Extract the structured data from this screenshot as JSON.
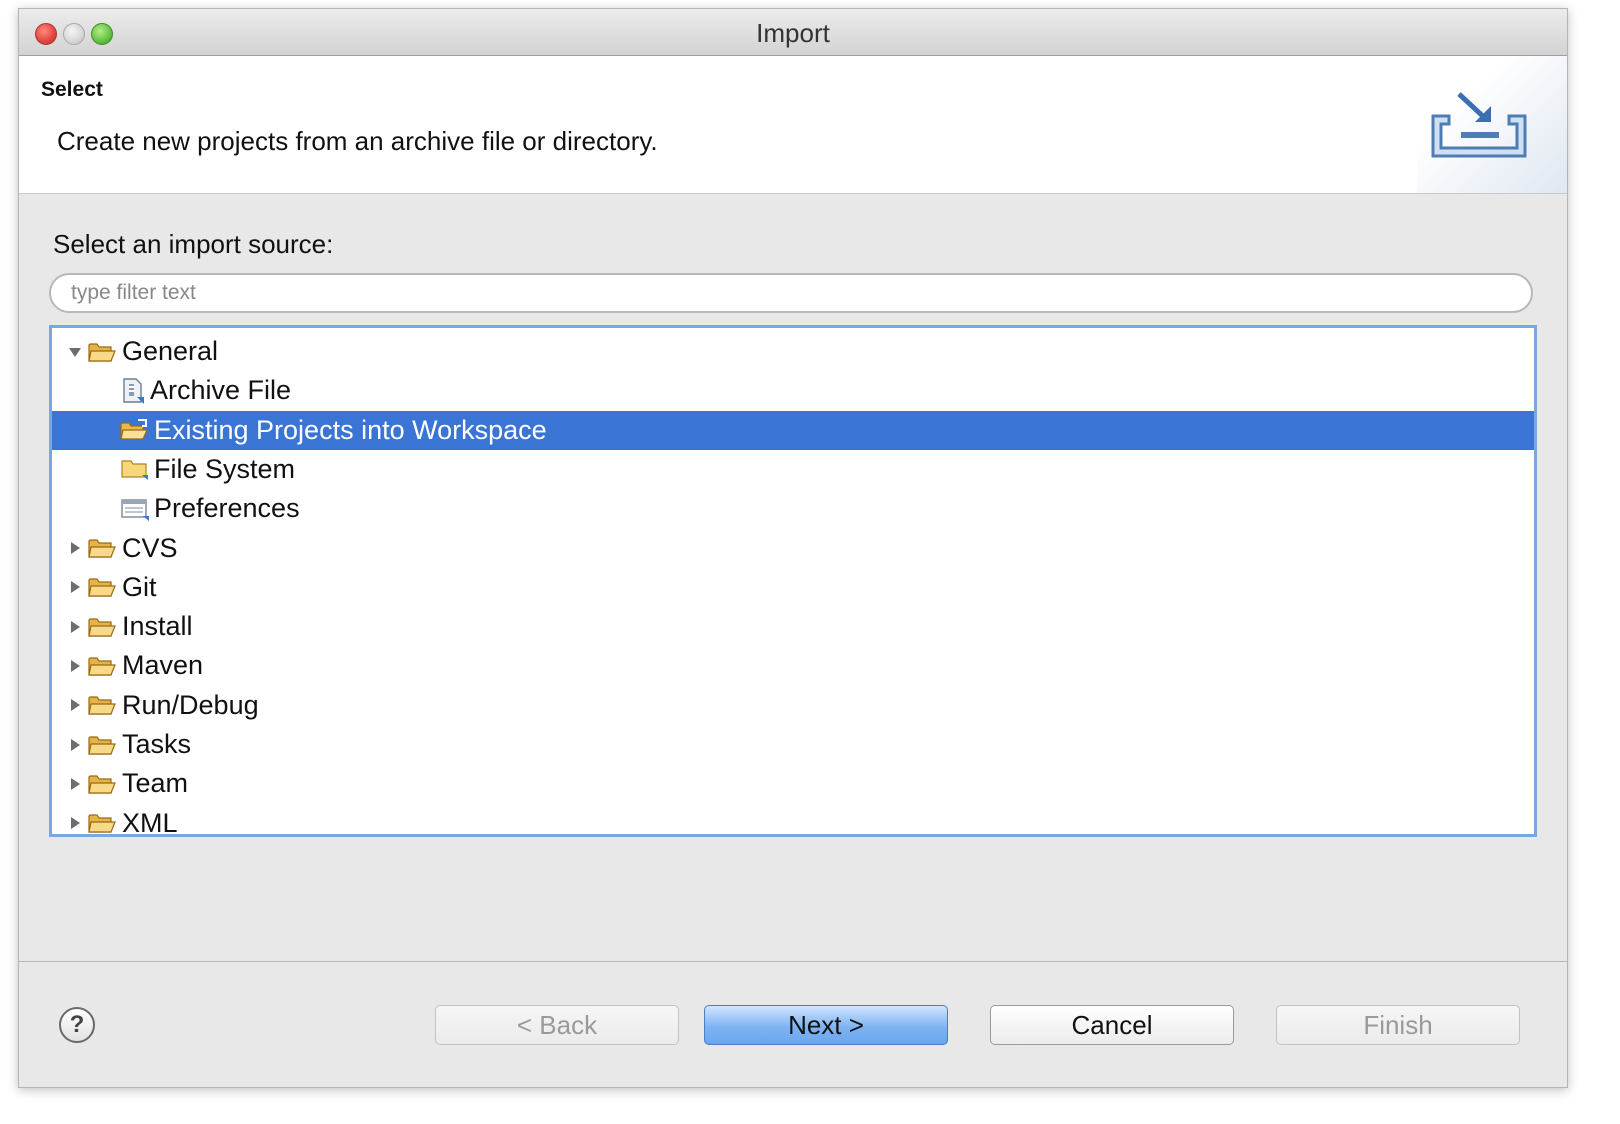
{
  "window": {
    "title": "Import"
  },
  "banner": {
    "title": "Select",
    "description": "Create new projects from an archive file or directory."
  },
  "source": {
    "label": "Select an import source:",
    "filter_placeholder": "type filter text"
  },
  "tree": {
    "items": [
      {
        "label": "General",
        "level": 0,
        "expanded": true,
        "icon": "folder-open-icon"
      },
      {
        "label": "Archive File",
        "level": 1,
        "icon": "archive-file-icon"
      },
      {
        "label": "Existing Projects into Workspace",
        "level": 1,
        "icon": "projects-folder-icon",
        "selected": true
      },
      {
        "label": "File System",
        "level": 1,
        "icon": "folder-icon"
      },
      {
        "label": "Preferences",
        "level": 1,
        "icon": "preferences-icon"
      },
      {
        "label": "CVS",
        "level": 0,
        "expanded": false,
        "icon": "folder-open-icon"
      },
      {
        "label": "Git",
        "level": 0,
        "expanded": false,
        "icon": "folder-open-icon"
      },
      {
        "label": "Install",
        "level": 0,
        "expanded": false,
        "icon": "folder-open-icon"
      },
      {
        "label": "Maven",
        "level": 0,
        "expanded": false,
        "icon": "folder-open-icon"
      },
      {
        "label": "Run/Debug",
        "level": 0,
        "expanded": false,
        "icon": "folder-open-icon"
      },
      {
        "label": "Tasks",
        "level": 0,
        "expanded": false,
        "icon": "folder-open-icon"
      },
      {
        "label": "Team",
        "level": 0,
        "expanded": false,
        "icon": "folder-open-icon"
      },
      {
        "label": "XML",
        "level": 0,
        "expanded": false,
        "icon": "folder-open-icon"
      }
    ]
  },
  "footer": {
    "help_symbol": "?",
    "back_label": "< Back",
    "next_label": "Next >",
    "cancel_label": "Cancel",
    "finish_label": "Finish"
  },
  "colors": {
    "selection": "#3a75d6",
    "tree_border": "#7aa7e0",
    "primary_button": "#7fb4f3"
  }
}
